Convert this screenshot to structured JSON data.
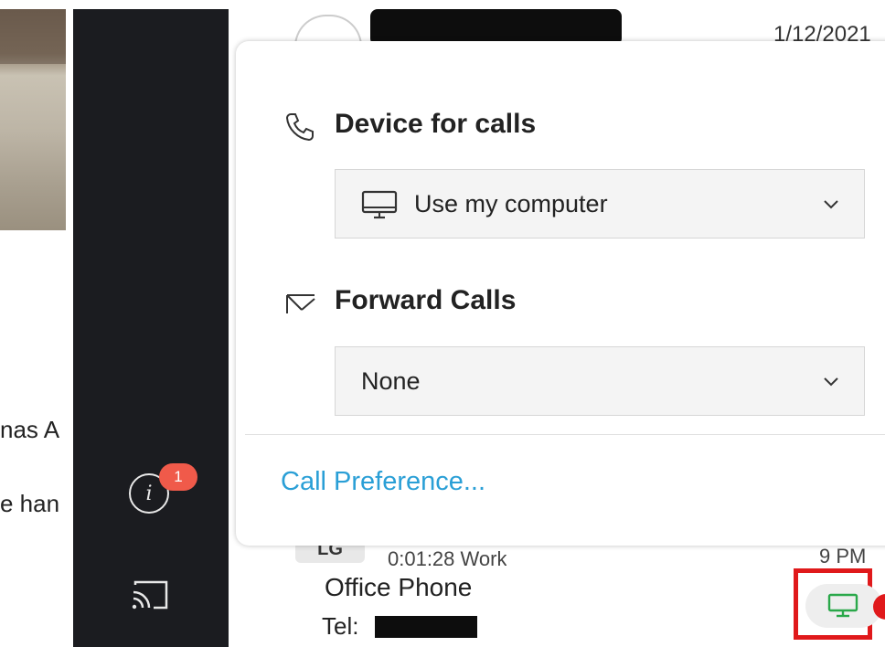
{
  "left_panel": {
    "text_1": "nas A",
    "text_2": "e han"
  },
  "rail": {
    "notification_count": "1"
  },
  "background_list": {
    "date": "1/12/2021",
    "chip": "LG",
    "duration": "0:01:28  Work",
    "time": "9 PM"
  },
  "popup": {
    "device_for_calls": {
      "title": "Device for calls",
      "selected": "Use my computer",
      "icon": "phone-icon"
    },
    "forward_calls": {
      "title": "Forward Calls",
      "selected": "None",
      "icon": "forward-arrow-icon"
    },
    "preference_link": "Call Preference..."
  },
  "status": {
    "line_label": "Office Phone",
    "tel_label": "Tel:",
    "device_icon": "monitor-icon",
    "accent_color": "#2aa84a",
    "highlight_color": "#e0191b",
    "link_color": "#2a9fd6"
  }
}
